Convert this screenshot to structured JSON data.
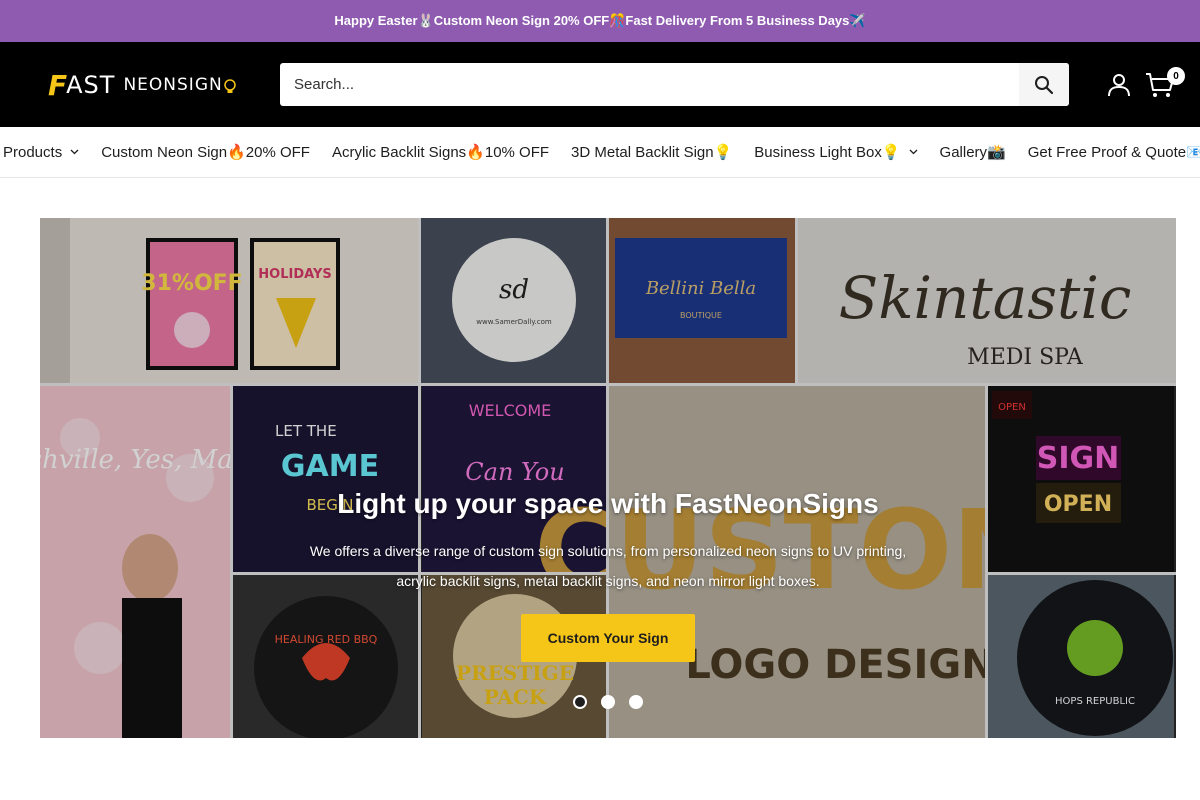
{
  "announcement": {
    "text": "Happy Easter🐰Custom Neon Sign 20% OFF🎊Fast Delivery From 5 Business Days✈️"
  },
  "header": {
    "logo": {
      "f": "F",
      "ast": "AST",
      "neon": "NEONSIGN"
    },
    "search": {
      "placeholder": "Search..."
    },
    "cart_count": "0"
  },
  "nav": {
    "items": [
      {
        "label": "Products",
        "dropdown": true
      },
      {
        "label": "Custom Neon Sign🔥20% OFF",
        "dropdown": false
      },
      {
        "label": "Acrylic Backlit Signs🔥10% OFF",
        "dropdown": false
      },
      {
        "label": "3D Metal Backlit Sign💡",
        "dropdown": false
      },
      {
        "label": "Business Light Box💡",
        "dropdown": true
      },
      {
        "label": "Gallery📸",
        "dropdown": false
      },
      {
        "label": "Get Free Proof & Quote📧",
        "dropdown": false
      }
    ]
  },
  "hero": {
    "title": "Light up your space with FastNeonSigns",
    "subtitle": "We offers a diverse range of custom sign solutions, from personalized neon signs to UV printing, acrylic backlit signs, metal backlit signs, and neon mirror light boxes.",
    "cta": "Custom Your Sign",
    "slides": 3,
    "active_slide": 1,
    "tiles": {
      "promo_31": "31%OFF",
      "promo_holidays": "HOLIDAYS",
      "sd_url": "www.SamerDally.com",
      "boutique_script": "Bellini Bella",
      "boutique": "BOUTIQUE",
      "skintastic": "Skintastic",
      "medi_spa": "MEDI SPA",
      "nashville": "Nashville, Yes, Maybe",
      "let_the": "LET THE",
      "game": "GAME",
      "begin": "BEGIN",
      "welcome": "WELCOME",
      "can_you": "Can You",
      "custom": "CUSTOM",
      "logo_design": "LOGO DESIGN",
      "open": "OPEN",
      "sign": "SIGN",
      "open2": "OPEN",
      "healing_red_bbq": "HEALING RED BBQ",
      "prestige": "PRESTIGE",
      "pack": "PACK",
      "hops_republic": "HOPS REPUBLIC"
    }
  },
  "colors": {
    "announcement_bg": "#8e5bb0",
    "header_bg": "#000000",
    "accent_yellow": "#f5c518"
  },
  "icons": {
    "search": "search-icon",
    "account": "user-icon",
    "cart": "cart-icon",
    "chevron": "chevron-down-icon"
  }
}
